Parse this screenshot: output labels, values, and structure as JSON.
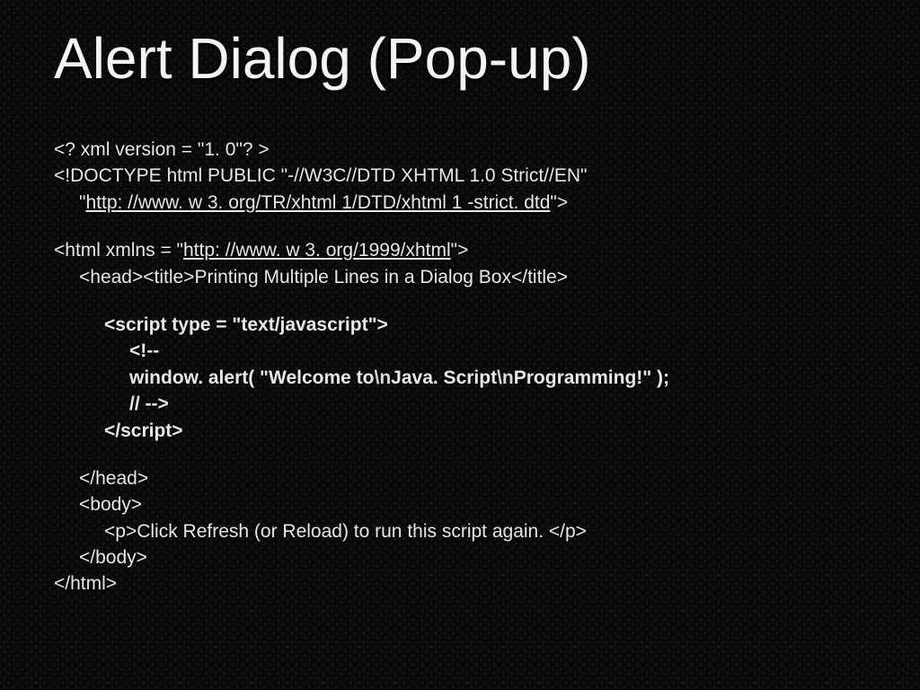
{
  "title": "Alert Dialog (Pop-up)",
  "code": {
    "xml_decl": "<? xml version = \"1. 0\"? >",
    "doctype_line": "<!DOCTYPE html PUBLIC \"-//W3C//DTD XHTML 1.0 Strict//EN\"",
    "doctype_prefix_indent": "\"",
    "doctype_url": "http: //www. w 3. org/TR/xhtml 1/DTD/xhtml 1 -strict. dtd",
    "doctype_suffix": "\">",
    "html_open_prefix": "<html xmlns = \"",
    "html_xmlns_url": "http: //www. w 3. org/1999/xhtml",
    "html_open_suffix": "\">",
    "head_title_line": "<head><title>Printing Multiple Lines in a Dialog Box</title>",
    "script_open": "<script type = \"text/javascript\">",
    "comment_open": "<!--",
    "alert_prefix": "window. alert( \"Welcome to",
    "alert_n1": "\\n",
    "alert_mid1": "Java. Script",
    "alert_n2": "\\n",
    "alert_mid2": "Programming!\" );",
    "comment_close": "// -->",
    "script_close": "</script>",
    "head_close": "</head>",
    "body_open": "<body>",
    "p_line": "<p>Click Refresh (or Reload) to run this script again. </p>",
    "body_close": "</body>",
    "html_close": "</html>"
  }
}
